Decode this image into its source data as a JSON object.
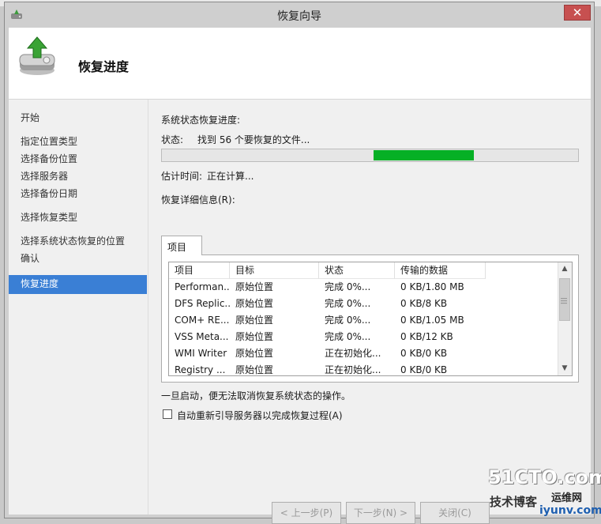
{
  "window": {
    "title": "恢复向导",
    "close_glyph": "✕"
  },
  "header": {
    "title": "恢复进度"
  },
  "nav": {
    "items": [
      {
        "label": "开始",
        "active": false
      },
      {
        "label": "指定位置类型",
        "active": false
      },
      {
        "label": "选择备份位置",
        "active": false
      },
      {
        "label": "选择服务器",
        "active": false
      },
      {
        "label": "选择备份日期",
        "active": false
      },
      {
        "label": "选择恢复类型",
        "active": false
      },
      {
        "label": "选择系统状态恢复的位置",
        "active": false
      },
      {
        "label": "确认",
        "active": false
      },
      {
        "label": "恢复进度",
        "active": true
      }
    ]
  },
  "main": {
    "progress_heading": "系统状态恢复进度:",
    "status_label": "状态:",
    "status_value": "找到 56 个要恢复的文件...",
    "progress_indicator": "marquee",
    "eta_label": "估计时间:",
    "eta_value": "正在计算...",
    "details_label": "恢复详细信息(R):",
    "tab_label": "项目",
    "columns": [
      "项目",
      "目标",
      "状态",
      "传输的数据"
    ],
    "rows": [
      [
        "Performan...",
        "原始位置",
        "完成 0%...",
        "0 KB/1.80 MB"
      ],
      [
        "DFS Replic...",
        "原始位置",
        "完成 0%...",
        "0 KB/8 KB"
      ],
      [
        "COM+ RE...",
        "原始位置",
        "完成 0%...",
        "0 KB/1.05 MB"
      ],
      [
        "VSS Meta...",
        "原始位置",
        "完成 0%...",
        "0 KB/12 KB"
      ],
      [
        "WMI Writer",
        "原始位置",
        "正在初始化...",
        "0 KB/0 KB"
      ],
      [
        "Registry ...",
        "原始位置",
        "正在初始化...",
        "0 KB/0 KB"
      ]
    ],
    "warning": "一旦启动，便无法取消恢复系统状态的操作。",
    "auto_restart_label": "自动重新引导服务器以完成恢复过程(A)",
    "auto_restart_checked": false
  },
  "buttons": {
    "back": "< 上一步(P)",
    "next": "下一步(N) >",
    "close": "关闭(C)"
  },
  "colors": {
    "accent": "#3a7fd5",
    "progress": "#06b025",
    "close": "#c75050"
  },
  "watermark": {
    "line1": "51CTO.com",
    "line2": "技术博客",
    "line3": "运维网",
    "line4": "iyunv.com"
  }
}
